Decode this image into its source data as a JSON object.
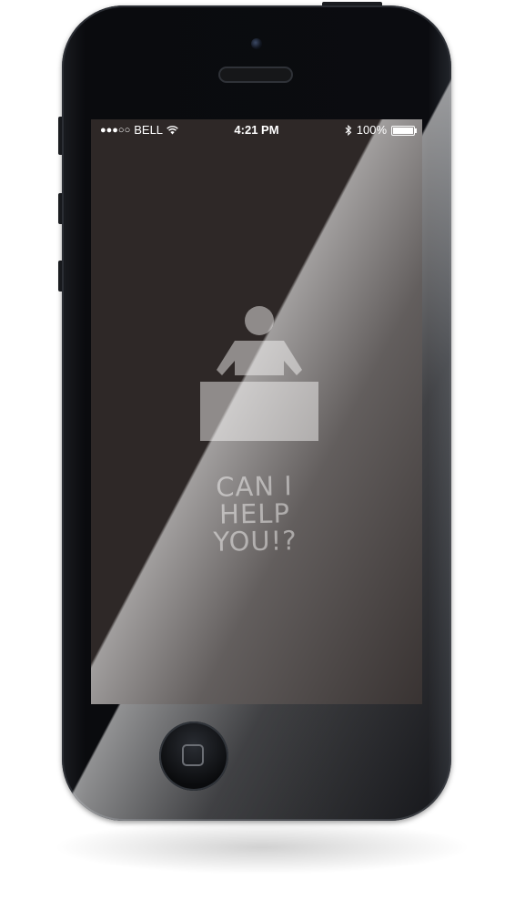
{
  "device": {
    "icons": [
      "camera-icon",
      "speaker-icon",
      "home-button-icon"
    ]
  },
  "statusbar": {
    "signal": "●●●○○",
    "carrier": "BELL",
    "time": "4:21 PM",
    "battery_percent": "100%",
    "battery_level": 1.0
  },
  "screen": {
    "background_color": "#2e2827",
    "icon": "help-desk-icon",
    "icon_color": "#8f8b8a",
    "tagline": [
      "CAN I",
      "HELP",
      "YOU!?"
    ]
  }
}
